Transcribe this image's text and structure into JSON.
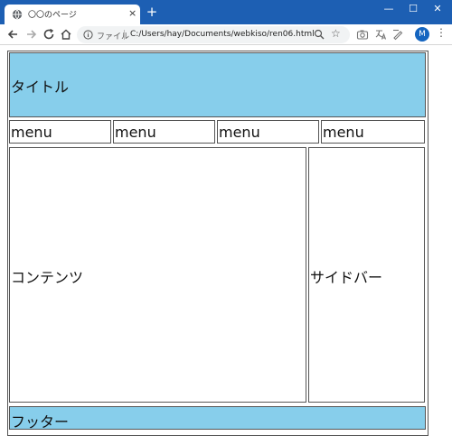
{
  "browser": {
    "tab_title": "〇〇のページ",
    "tab_close": "×",
    "new_tab": "+",
    "window": {
      "minimize": "—",
      "maximize": "☐",
      "close": "✕"
    },
    "address": {
      "file_label": "ファイル",
      "url": "C:/Users/hay/Documents/webkiso/ren06.html"
    },
    "profile_initial": "M",
    "menu_glyph": "⋮",
    "star_glyph": "☆"
  },
  "page": {
    "title": "タイトル",
    "menu": [
      "menu",
      "menu",
      "menu",
      "menu"
    ],
    "content": "コンテンツ",
    "sidebar": "サイドバー",
    "footer": "フッター"
  },
  "colors": {
    "tabbar": "#1d5fb3",
    "header_footer_bg": "#87ceeb",
    "border": "#555555"
  }
}
